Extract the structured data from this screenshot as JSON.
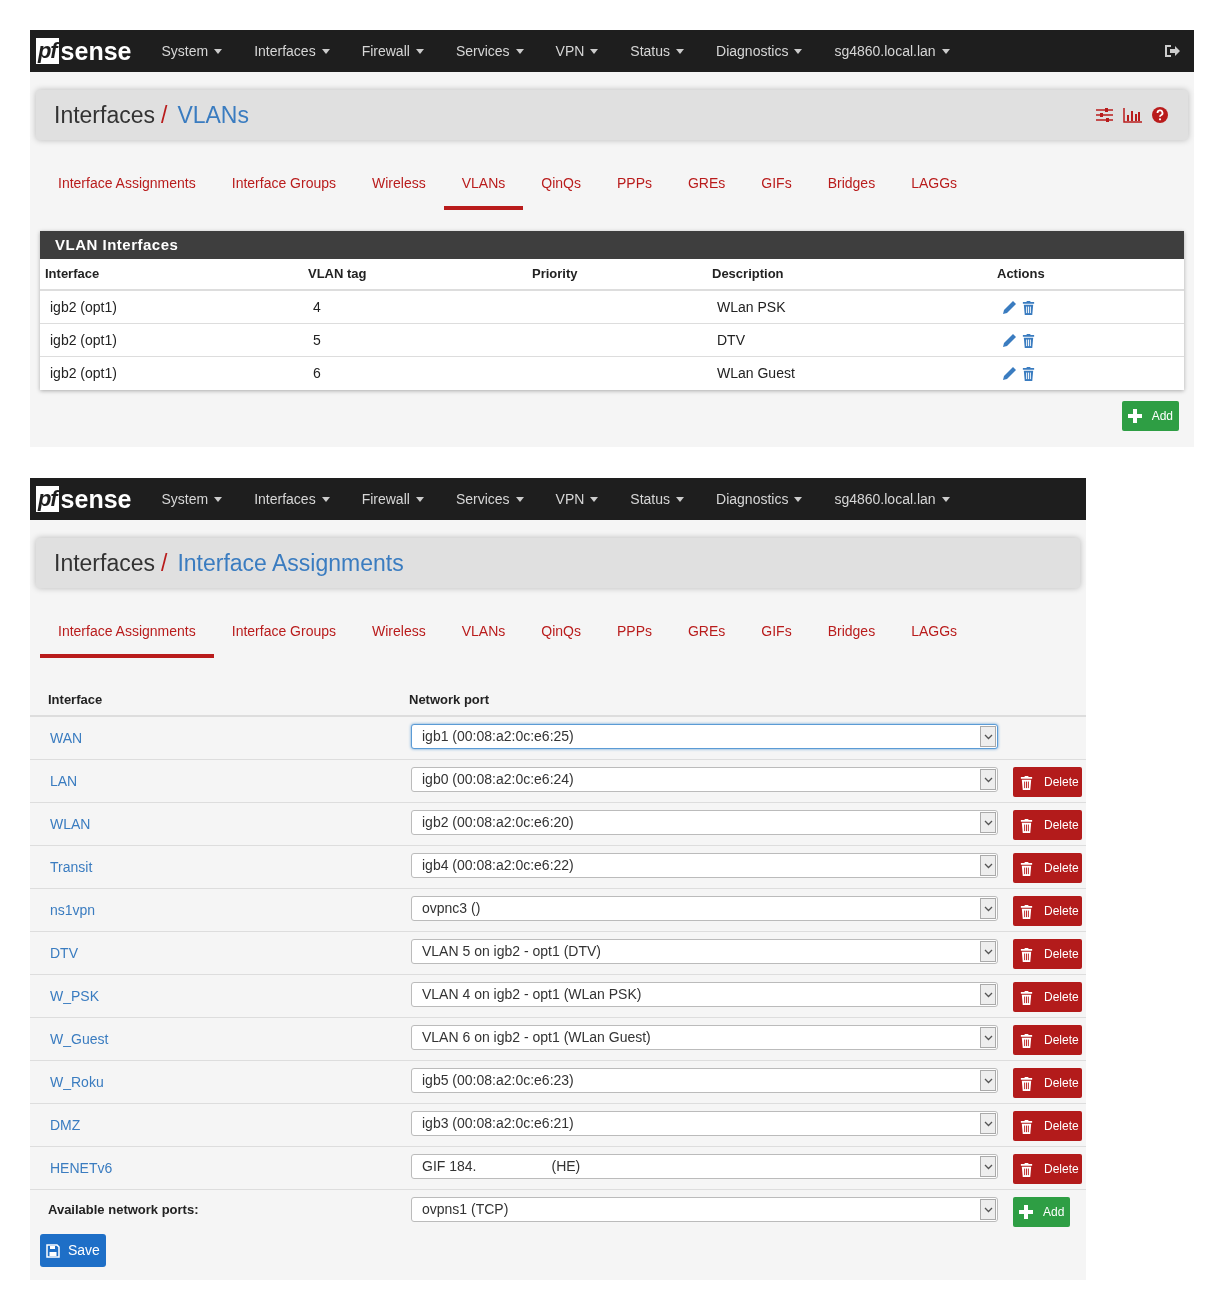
{
  "screens": [
    {
      "navbar": {
        "logo": {
          "box": "pf",
          "text": "sense"
        },
        "menus": [
          "System",
          "Interfaces",
          "Firewall",
          "Services",
          "VPN",
          "Status",
          "Diagnostics",
          "sg4860.local.lan"
        ],
        "logout": true
      },
      "header": {
        "section": "Interfaces",
        "separator": "/",
        "page": "VLANs",
        "tools": true
      },
      "tabs": [
        {
          "label": "Interface Assignments",
          "selected": false
        },
        {
          "label": "Interface Groups",
          "selected": false
        },
        {
          "label": "Wireless",
          "selected": false
        },
        {
          "label": "VLANs",
          "selected": true
        },
        {
          "label": "QinQs",
          "selected": false
        },
        {
          "label": "PPPs",
          "selected": false
        },
        {
          "label": "GREs",
          "selected": false
        },
        {
          "label": "GIFs",
          "selected": false
        },
        {
          "label": "Bridges",
          "selected": false
        },
        {
          "label": "LAGGs",
          "selected": false
        }
      ],
      "kind": "vlans",
      "panel": {
        "title": "VLAN Interfaces",
        "columns": [
          "Interface",
          "VLAN tag",
          "Priority",
          "Description",
          "Actions"
        ],
        "rows": [
          {
            "interface": "igb2 (opt1)",
            "tag": "4",
            "description": "WLan PSK"
          },
          {
            "interface": "igb2 (opt1)",
            "tag": "5",
            "description": "DTV"
          },
          {
            "interface": "igb2 (opt1)",
            "tag": "6",
            "description": "WLan Guest"
          }
        ]
      },
      "add_button": "Add"
    },
    {
      "navbar": {
        "logo": {
          "box": "pf",
          "text": "sense"
        },
        "menus": [
          "System",
          "Interfaces",
          "Firewall",
          "Services",
          "VPN",
          "Status",
          "Diagnostics",
          "sg4860.local.lan"
        ],
        "logout": false
      },
      "header": {
        "section": "Interfaces",
        "separator": "/",
        "page": "Interface Assignments",
        "tools": false
      },
      "tabs": [
        {
          "label": "Interface Assignments",
          "selected": true
        },
        {
          "label": "Interface Groups",
          "selected": false
        },
        {
          "label": "Wireless",
          "selected": false
        },
        {
          "label": "VLANs",
          "selected": false
        },
        {
          "label": "QinQs",
          "selected": false
        },
        {
          "label": "PPPs",
          "selected": false
        },
        {
          "label": "GREs",
          "selected": false
        },
        {
          "label": "GIFs",
          "selected": false
        },
        {
          "label": "Bridges",
          "selected": false
        },
        {
          "label": "LAGGs",
          "selected": false
        }
      ],
      "kind": "assignments",
      "columns": [
        "Interface",
        "Network port"
      ],
      "rows": [
        {
          "interface": "WAN",
          "port": "igb1 (00:08:a2:0c:e6:25)",
          "focused": true
        },
        {
          "interface": "LAN",
          "port": "igb0 (00:08:a2:0c:e6:24)",
          "focused": false,
          "delete": "Delete"
        },
        {
          "interface": "WLAN",
          "port": "igb2 (00:08:a2:0c:e6:20)",
          "focused": false,
          "delete": "Delete"
        },
        {
          "interface": "Transit",
          "port": "igb4 (00:08:a2:0c:e6:22)",
          "focused": false,
          "delete": "Delete"
        },
        {
          "interface": "ns1vpn",
          "port": "ovpnc3 ()",
          "focused": false,
          "delete": "Delete"
        },
        {
          "interface": "DTV",
          "port": "VLAN 5 on igb2 - opt1 (DTV)",
          "focused": false,
          "delete": "Delete"
        },
        {
          "interface": "W_PSK",
          "port": "VLAN 4 on igb2 - opt1 (WLan PSK)",
          "focused": false,
          "delete": "Delete"
        },
        {
          "interface": "W_Guest",
          "port": "VLAN 6 on igb2 - opt1 (WLan Guest)",
          "focused": false,
          "delete": "Delete"
        },
        {
          "interface": "W_Roku",
          "port": "igb5 (00:08:a2:0c:e6:23)",
          "focused": false,
          "delete": "Delete"
        },
        {
          "interface": "DMZ",
          "port": "igb3 (00:08:a2:0c:e6:21)",
          "focused": false,
          "delete": "Delete"
        },
        {
          "interface": "HENETv6",
          "port": "GIF 184.",
          "port_suffix": "(HE)",
          "focused": false,
          "delete": "Delete"
        }
      ],
      "available": {
        "label": "Available network ports:",
        "port": "ovpns1 (TCP)",
        "add": "Add"
      },
      "save_button": "Save"
    }
  ]
}
